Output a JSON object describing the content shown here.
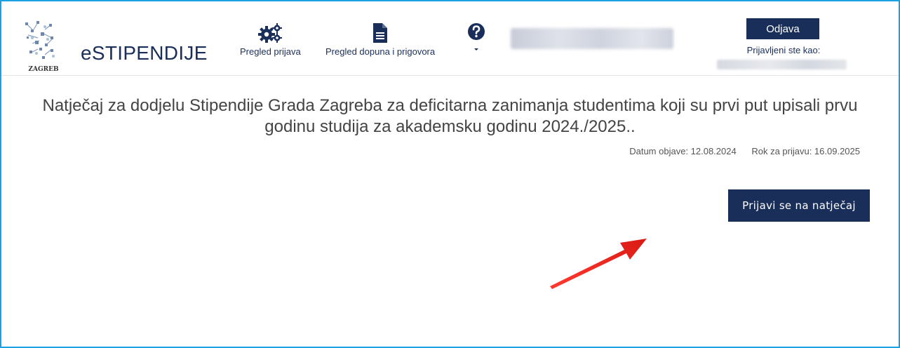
{
  "header": {
    "logo_text": "ZAGREB",
    "brand": "eSTIPENDIJE",
    "nav": [
      {
        "label": "Pregled prijava",
        "icon": "gears-icon"
      },
      {
        "label": "Pregled dopuna i prigovora",
        "icon": "document-icon"
      },
      {
        "label": "",
        "icon": "help-icon"
      }
    ],
    "logout_label": "Odjava",
    "logged_in_label": "Prijavljeni ste kao:"
  },
  "main": {
    "title": "Natječaj za dodjelu Stipendije Grada Zagreba za deficitarna zanimanja studentima koji su prvi put upisali prvu godinu studija za akademsku godinu 2024./2025..",
    "publish_date": "Datum objave: 12.08.2024",
    "deadline": "Rok za prijavu: 16.09.2025",
    "apply_label": "Prijavi se na natječaj"
  },
  "colors": {
    "brand": "#1a2e5a",
    "frame": "#1ba1e2",
    "arrow": "#e8221b"
  }
}
